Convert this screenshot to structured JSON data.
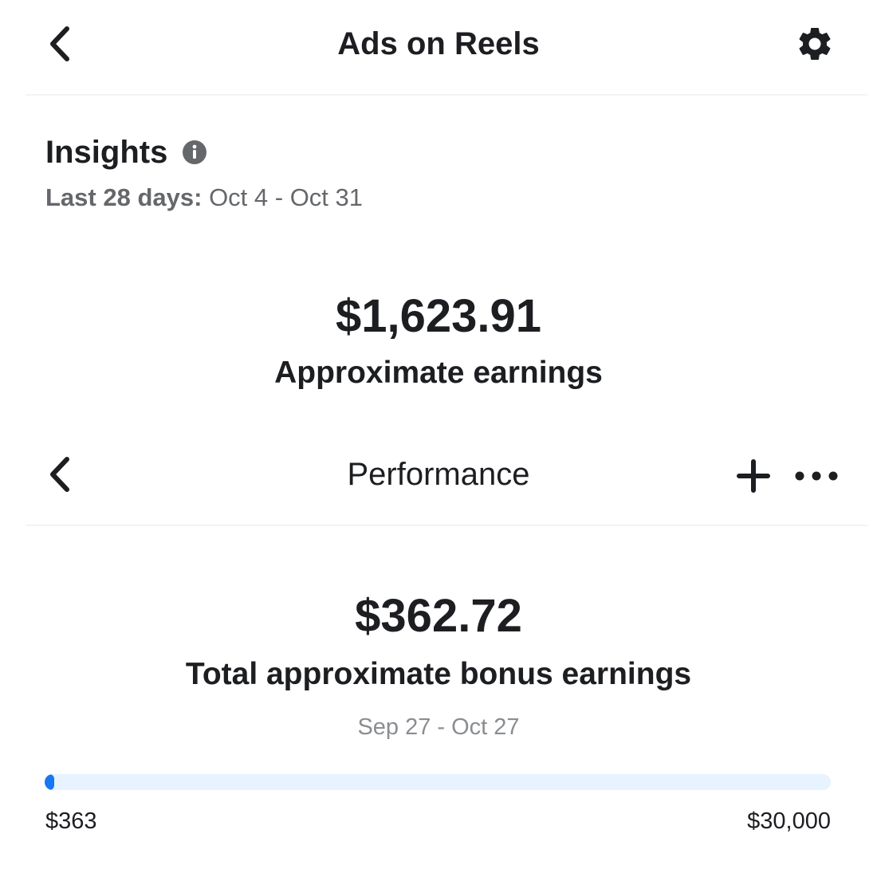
{
  "header": {
    "title": "Ads on Reels",
    "back_icon": "chevron-left-icon",
    "settings_icon": "gear-icon"
  },
  "insights": {
    "title": "Insights",
    "info_icon": "info-icon",
    "range_label": "Last 28 days:",
    "range_value": "Oct 4 - Oct 31",
    "amount": "$1,623.91",
    "amount_label": "Approximate earnings"
  },
  "performance": {
    "title": "Performance",
    "back_icon": "chevron-left-icon",
    "add_icon": "plus-icon",
    "more_icon": "more-horizontal-icon",
    "amount": "$362.72",
    "amount_label": "Total approximate bonus earnings",
    "dates": "Sep 27 - Oct 27",
    "progress": {
      "current_label": "$363",
      "target_label": "$30,000",
      "current_value": 362.72,
      "target_value": 30000
    }
  },
  "colors": {
    "accent": "#1877f2",
    "track": "#e7f3ff",
    "text_primary": "#1c1e21",
    "text_secondary": "#65676b"
  }
}
